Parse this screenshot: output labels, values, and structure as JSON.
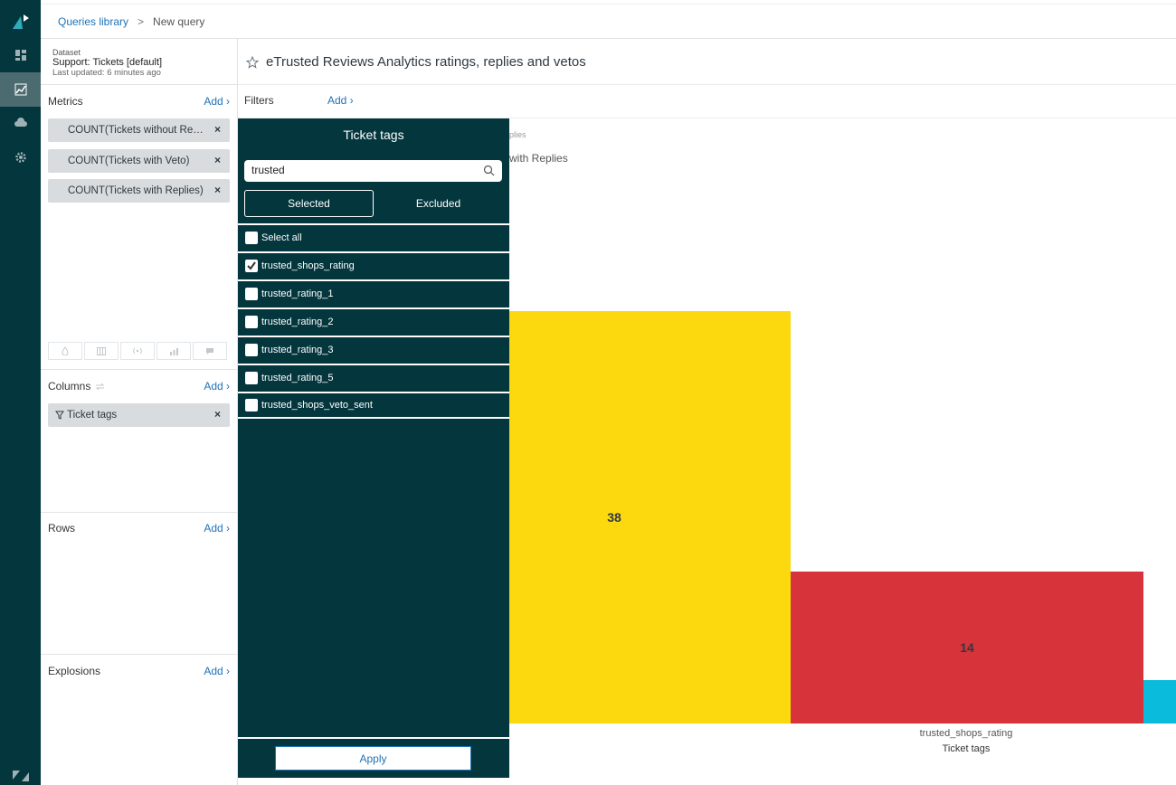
{
  "breadcrumb": {
    "library": "Queries library",
    "separator": ">",
    "current": "New query"
  },
  "dataset": {
    "label": "Dataset",
    "name": "Support: Tickets [default]",
    "updated": "Last updated: 6 minutes ago"
  },
  "metrics": {
    "title": "Metrics",
    "add": "Add ›",
    "items": [
      "COUNT(Tickets without Repli...",
      "COUNT(Tickets with Veto)",
      "COUNT(Tickets with Replies)"
    ],
    "remove_glyph": "×"
  },
  "columns": {
    "title": "Columns",
    "add": "Add ›",
    "items": [
      "Ticket tags"
    ]
  },
  "rows": {
    "title": "Rows",
    "add": "Add ›"
  },
  "explosions": {
    "title": "Explosions",
    "add": "Add ›"
  },
  "query_title": "eTrusted Reviews Analytics ratings, replies and vetos",
  "filters": {
    "title": "Filters",
    "add": "Add ›"
  },
  "legend": {
    "small": "plies",
    "main": "with Replies"
  },
  "popup": {
    "title": "Ticket tags",
    "search_value": "trusted",
    "tab_selected": "Selected",
    "tab_excluded": "Excluded",
    "options": [
      {
        "label": "Select all",
        "checked": false
      },
      {
        "label": "trusted_shops_rating",
        "checked": true
      },
      {
        "label": "trusted_rating_1",
        "checked": false
      },
      {
        "label": "trusted_rating_2",
        "checked": false
      },
      {
        "label": "trusted_rating_3",
        "checked": false
      },
      {
        "label": "trusted_rating_5",
        "checked": false
      },
      {
        "label": "trusted_shops_veto_sent",
        "checked": false
      }
    ],
    "apply": "Apply"
  },
  "colors": {
    "yellow": "#fcd90f",
    "red": "#d6333b",
    "cyan": "#0bbbdb",
    "nav": "#03363d",
    "link": "#1f73b7"
  },
  "chart_data": {
    "type": "bar",
    "categories": [
      "trusted_shops_rating"
    ],
    "xlabel": "Ticket tags",
    "ylabel": "",
    "ylim": [
      0,
      50
    ],
    "series": [
      {
        "name": "",
        "values": [
          38
        ],
        "color": "#fcd90f"
      },
      {
        "name": "",
        "values": [
          14
        ],
        "color": "#d6333b"
      },
      {
        "name": "",
        "values": [
          4
        ],
        "color": "#0bbbdb"
      }
    ]
  }
}
